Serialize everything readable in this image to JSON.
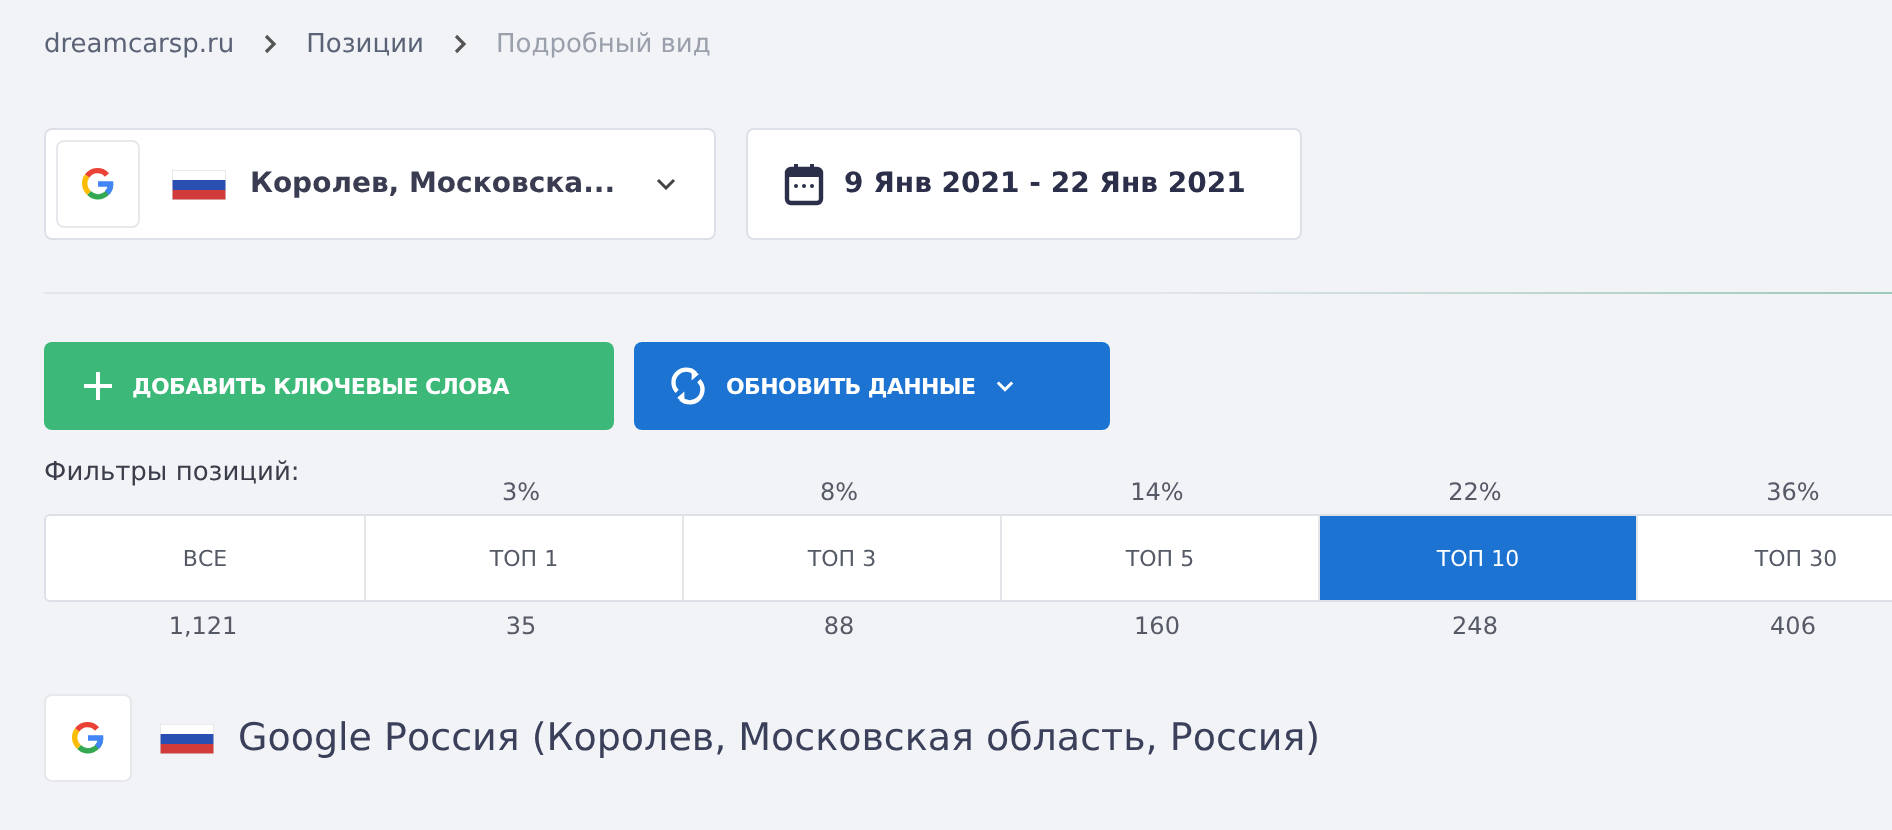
{
  "breadcrumb": [
    {
      "label": "dreamcarsp.ru",
      "current": false
    },
    {
      "label": "Позиции",
      "current": false
    },
    {
      "label": "Подробный вид",
      "current": true
    }
  ],
  "region_select": {
    "value": "Королев, Московска..."
  },
  "date_range": {
    "value": "9 Янв 2021 - 22 Янв 2021"
  },
  "buttons": [
    {
      "kind": "add",
      "label": "ДОБАВИТЬ КЛЮЧЕВЫЕ СЛОВА"
    },
    {
      "kind": "refresh",
      "label": "ОБНОВИТЬ ДАННЫЕ"
    }
  ],
  "filters_label": "Фильтры позиций:",
  "filters": [
    {
      "label": "ВСЕ",
      "count": "1,121",
      "selected": false
    },
    {
      "label": "ТОП 1",
      "percent": "3%",
      "count": "35",
      "selected": false
    },
    {
      "label": "ТОП 3",
      "percent": "8%",
      "count": "88",
      "selected": false
    },
    {
      "label": "ТОП 5",
      "percent": "14%",
      "count": "160",
      "selected": false
    },
    {
      "label": "ТОП 10",
      "percent": "22%",
      "count": "248",
      "selected": true
    },
    {
      "label": "ТОП 30",
      "percent": "36%",
      "count": "406",
      "selected": false
    }
  ],
  "section_title": "Google Россия (Королев, Московская область, Россия)"
}
